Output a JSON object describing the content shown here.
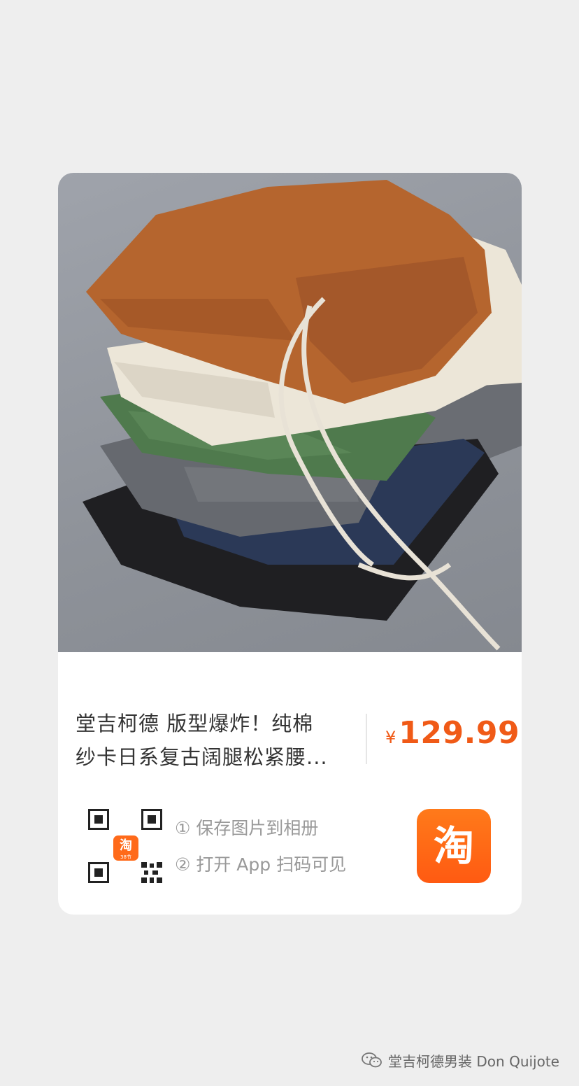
{
  "product": {
    "title_line1": "堂吉柯德 版型爆炸！纯棉",
    "title_line2": "纱卡日系复古阔腿松紧腰...",
    "currency": "¥",
    "price": "129.99"
  },
  "qr_badge": {
    "glyph": "淘",
    "caption": "38节"
  },
  "steps": [
    "① 保存图片到相册",
    "② 打开 App 扫码可见"
  ],
  "app_icon": {
    "glyph": "淘",
    "color": "#ff6a1a"
  },
  "footer": {
    "account": "堂吉柯德男装 Don Quijote"
  },
  "colors": {
    "price": "#f05a17",
    "pants": [
      "#b5652e",
      "#ece6d8",
      "#4f7a4d",
      "#6b6f76",
      "#2c3a5a",
      "#1e1e20"
    ]
  }
}
